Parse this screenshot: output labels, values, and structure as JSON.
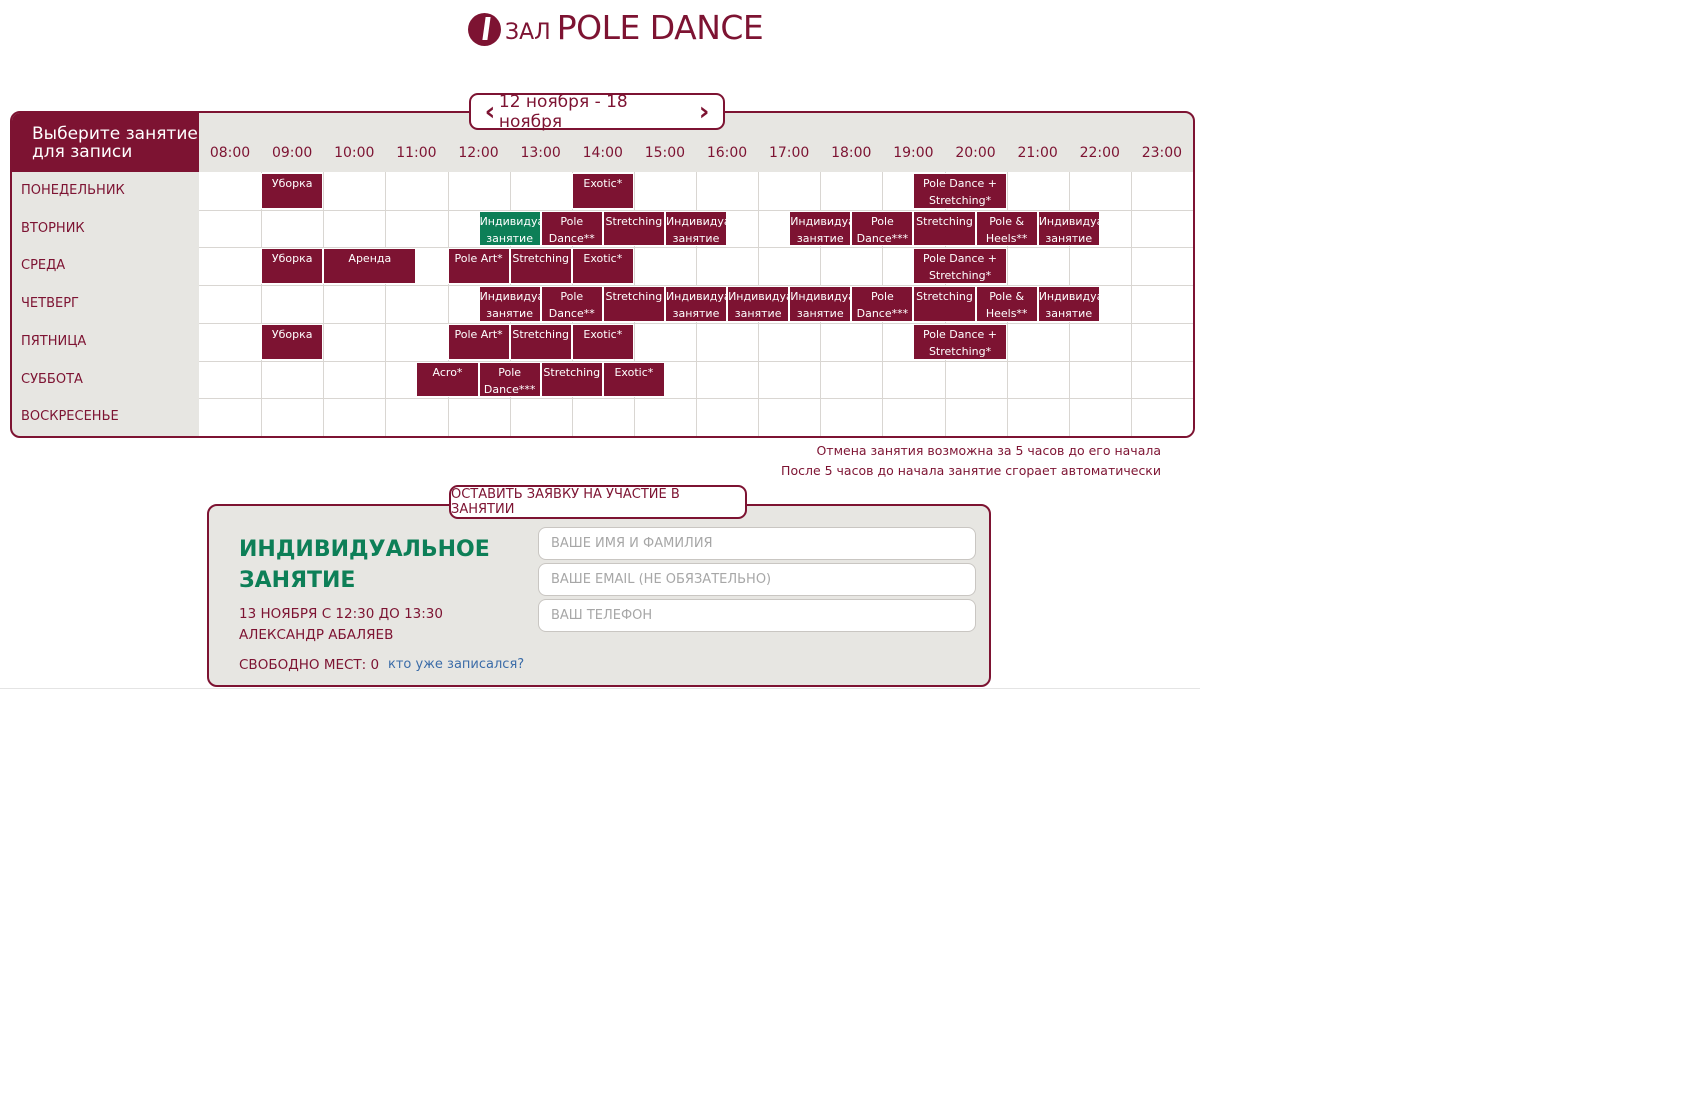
{
  "header": {
    "hall_prefix": "ЗАЛ",
    "hall_name": "POLE DANCE"
  },
  "schedule": {
    "corner_label": "Выберите занятие\nдля записи",
    "week_label": "12 ноября - 18 ноября",
    "hours": [
      "08:00",
      "09:00",
      "10:00",
      "11:00",
      "12:00",
      "13:00",
      "14:00",
      "15:00",
      "16:00",
      "17:00",
      "18:00",
      "19:00",
      "20:00",
      "21:00",
      "22:00",
      "23:00"
    ],
    "days": [
      "ПОНЕДЕЛЬНИК",
      "ВТОРНИК",
      "СРЕДА",
      "ЧЕТВЕРГ",
      "ПЯТНИЦА",
      "СУББОТА",
      "ВОСКРЕСЕНЬЕ"
    ],
    "lessons": [
      {
        "day": 0,
        "start": 9,
        "dur": 1,
        "label": "Уборка"
      },
      {
        "day": 0,
        "start": 14,
        "dur": 1,
        "label": "Exotic*"
      },
      {
        "day": 0,
        "start": 19.5,
        "dur": 1.5,
        "label": "Pole Dance +\nStretching*"
      },
      {
        "day": 1,
        "start": 12.5,
        "dur": 1,
        "label": "Индивидуальное\nзанятие",
        "active": true
      },
      {
        "day": 1,
        "start": 13.5,
        "dur": 1,
        "label": "Pole\nDance**"
      },
      {
        "day": 1,
        "start": 14.5,
        "dur": 1,
        "label": "Stretching"
      },
      {
        "day": 1,
        "start": 15.5,
        "dur": 1,
        "label": "Индивидуальное\nзанятие"
      },
      {
        "day": 1,
        "start": 17.5,
        "dur": 1,
        "label": "Индивидуальное\nзанятие"
      },
      {
        "day": 1,
        "start": 18.5,
        "dur": 1,
        "label": "Pole\nDance***"
      },
      {
        "day": 1,
        "start": 19.5,
        "dur": 1,
        "label": "Stretching"
      },
      {
        "day": 1,
        "start": 20.5,
        "dur": 1,
        "label": "Pole &\nHeels**"
      },
      {
        "day": 1,
        "start": 21.5,
        "dur": 1,
        "label": "Индивидуальное\nзанятие"
      },
      {
        "day": 2,
        "start": 9,
        "dur": 1,
        "label": "Уборка"
      },
      {
        "day": 2,
        "start": 10,
        "dur": 1.5,
        "label": "Аренда"
      },
      {
        "day": 2,
        "start": 12,
        "dur": 1,
        "label": "Pole Art*"
      },
      {
        "day": 2,
        "start": 13,
        "dur": 1,
        "label": "Stretching"
      },
      {
        "day": 2,
        "start": 14,
        "dur": 1,
        "label": "Exotic*"
      },
      {
        "day": 2,
        "start": 19.5,
        "dur": 1.5,
        "label": "Pole Dance +\nStretching*"
      },
      {
        "day": 3,
        "start": 12.5,
        "dur": 1,
        "label": "Индивидуальное\nзанятие"
      },
      {
        "day": 3,
        "start": 13.5,
        "dur": 1,
        "label": "Pole\nDance**"
      },
      {
        "day": 3,
        "start": 14.5,
        "dur": 1,
        "label": "Stretching"
      },
      {
        "day": 3,
        "start": 15.5,
        "dur": 1,
        "label": "Индивидуальное\nзанятие"
      },
      {
        "day": 3,
        "start": 16.5,
        "dur": 1,
        "label": "Индивидуальное\nзанятие"
      },
      {
        "day": 3,
        "start": 17.5,
        "dur": 1,
        "label": "Индивидуальное\nзанятие"
      },
      {
        "day": 3,
        "start": 18.5,
        "dur": 1,
        "label": "Pole\nDance***"
      },
      {
        "day": 3,
        "start": 19.5,
        "dur": 1,
        "label": "Stretching"
      },
      {
        "day": 3,
        "start": 20.5,
        "dur": 1,
        "label": "Pole &\nHeels**"
      },
      {
        "day": 3,
        "start": 21.5,
        "dur": 1,
        "label": "Индивидуальное\nзанятие"
      },
      {
        "day": 4,
        "start": 9,
        "dur": 1,
        "label": "Уборка"
      },
      {
        "day": 4,
        "start": 12,
        "dur": 1,
        "label": "Pole Art*"
      },
      {
        "day": 4,
        "start": 13,
        "dur": 1,
        "label": "Stretching"
      },
      {
        "day": 4,
        "start": 14,
        "dur": 1,
        "label": "Exotic*"
      },
      {
        "day": 4,
        "start": 19.5,
        "dur": 1.5,
        "label": "Pole Dance +\nStretching*"
      },
      {
        "day": 5,
        "start": 11.5,
        "dur": 1,
        "label": "Acro*"
      },
      {
        "day": 5,
        "start": 12.5,
        "dur": 1,
        "label": "Pole\nDance***"
      },
      {
        "day": 5,
        "start": 13.5,
        "dur": 1,
        "label": "Stretching"
      },
      {
        "day": 5,
        "start": 14.5,
        "dur": 1,
        "label": "Exotic*"
      }
    ],
    "notes": [
      "Отмена занятия возможна за 5 часов до его начала",
      "После 5 часов до начала занятие сгорает автоматически"
    ]
  },
  "booking": {
    "tab_label": "ОСТАВИТЬ ЗАЯВКУ НА УЧАСТИЕ В ЗАНЯТИИ",
    "class_name": "ИНДИВИДУАЛЬНОЕ ЗАНЯТИЕ",
    "class_time": "13 НОЯБРЯ С 12:30 ДО 13:30",
    "trainer": "АЛЕКСАНДР АБАЛЯЕВ",
    "spots": "СВОБОДНО МЕСТ: 0",
    "who_link": "кто уже записался?",
    "name_placeholder": "ВАШЕ ИМЯ И ФАМИЛИЯ",
    "email_placeholder": "ВАШЕ EMAIL (НЕ ОБЯЗАТЕЛЬНО)",
    "phone_placeholder": "ВАШ ТЕЛЕФОН"
  },
  "colors": {
    "brand": "#7d1332",
    "active": "#0d7f57",
    "panel": "#e7e6e2"
  },
  "icons": {
    "prev": "chevron-left-icon",
    "next": "chevron-right-icon",
    "logo": "hall-number-icon"
  }
}
